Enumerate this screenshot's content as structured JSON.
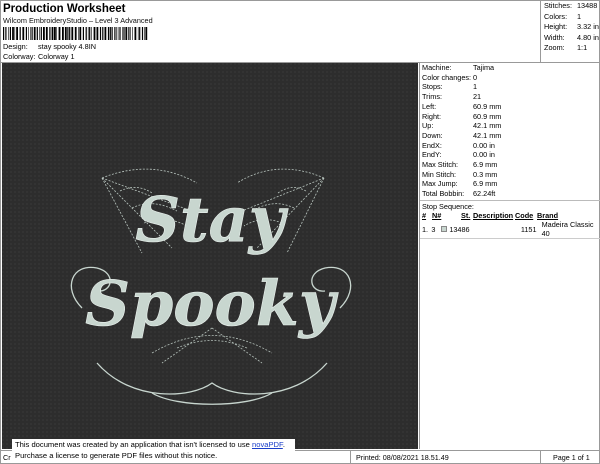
{
  "header": {
    "title": "Production Worksheet",
    "subtitle": "Wilcom EmbroideryStudio – Level 3 Advanced",
    "design_label": "Design:",
    "design_value": "stay spooky 4.8IN",
    "colorway_label": "Colorway:",
    "colorway_value": "Colorway 1"
  },
  "summary": {
    "stitches_label": "Stitches:",
    "stitches_value": "13488",
    "colors_label": "Colors:",
    "colors_value": "1",
    "height_label": "Height:",
    "height_value": "3.32 in",
    "width_label": "Width:",
    "width_value": "4.80 in",
    "zoom_label": "Zoom:",
    "zoom_value": "1:1"
  },
  "design_preview": {
    "word1": "Stay",
    "word2": "Spooky",
    "background_color": "#2d2d2d",
    "thread_color": "#c8d6cf"
  },
  "machine_info": [
    {
      "k": "Machine:",
      "v": "Tajima"
    },
    {
      "k": "Color changes:",
      "v": "0"
    },
    {
      "k": "Stops:",
      "v": "1"
    },
    {
      "k": "Trims:",
      "v": "21"
    },
    {
      "k": "Left:",
      "v": "60.9 mm"
    },
    {
      "k": "Right:",
      "v": "60.9 mm"
    },
    {
      "k": "Up:",
      "v": "42.1 mm"
    },
    {
      "k": "Down:",
      "v": "42.1 mm"
    },
    {
      "k": "EndX:",
      "v": "0.00 in"
    },
    {
      "k": "EndY:",
      "v": "0.00 in"
    },
    {
      "k": "Max Stitch:",
      "v": "6.9 mm"
    },
    {
      "k": "Min Stitch:",
      "v": "0.3 mm"
    },
    {
      "k": "Max Jump:",
      "v": "6.9 mm"
    },
    {
      "k": "Total Bobbin:",
      "v": "62.24ft"
    }
  ],
  "stop_sequence": {
    "title": "Stop Sequence:",
    "columns": [
      "#",
      "N#",
      "St.",
      "Description",
      "Code",
      "Brand"
    ],
    "rows": [
      {
        "num": "1.",
        "n": "3",
        "st": "13486",
        "desc": "",
        "code": "1151",
        "brand": "Madeira Classic 40"
      }
    ]
  },
  "footer": {
    "left": "Cr",
    "printed": "Printed: 08/08/2021 18.51.49",
    "page": "Page 1 of 1"
  },
  "notice": {
    "line1_prefix": "This document was created by an application that isn't licensed to use ",
    "link": "novaPDF",
    "line1_suffix": ".",
    "line2": "Purchase a license to generate PDF files without this notice."
  }
}
